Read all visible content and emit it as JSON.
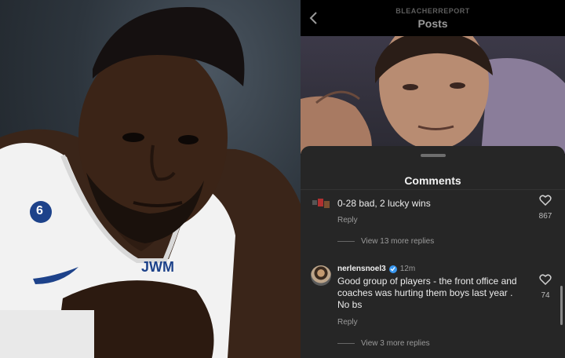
{
  "header": {
    "account": "BLEACHERREPORT",
    "title": "Posts"
  },
  "left_photo": {
    "jersey_number": "6",
    "sponsor": "JWM"
  },
  "comments_sheet": {
    "title": "Comments",
    "comments": [
      {
        "text": "0-28 bad, 2 lucky wins",
        "reply_label": "Reply",
        "likes": "867",
        "view_more": "View 13 more replies"
      },
      {
        "username": "nerlensnoel3",
        "verified": true,
        "time": "12m",
        "text": "Good group of players - the front office and coaches was hurting them boys last year . No bs",
        "reply_label": "Reply",
        "likes": "74",
        "view_more": "View 3 more replies"
      }
    ]
  },
  "colors": {
    "sheet_bg": "#262626",
    "verified_blue": "#3897f0",
    "jersey_blue": "#1d428a",
    "text_primary": "#ececec",
    "text_secondary": "#9a9a9a"
  }
}
